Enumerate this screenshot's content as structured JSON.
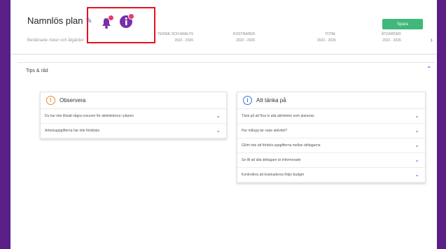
{
  "header": {
    "plan_name": "Namnlös plan",
    "edit_icon": "pencil-icon",
    "subtext": "Beräknade risker och åtgärder",
    "save_label": "Spara",
    "stats": [
      {
        "label": "TEKNIK OCH ANALYS",
        "value": "2022 - 2026"
      },
      {
        "label": "KOSTNADER",
        "value": "2022 - 2026"
      },
      {
        "label": "TOTAL",
        "value": "2022 - 2026"
      },
      {
        "label": "ÅTGÄRDER",
        "value": "2022 - 2026"
      }
    ],
    "notifications": {
      "bell_icon": "bell-icon",
      "info_icon": "info-icon"
    }
  },
  "panel": {
    "title": "Tips & råd",
    "observation_card": {
      "title": "Observera",
      "items": [
        "Du har inte tillsatt några resurser för aktiviteterna i planen",
        "Arbetsuppgifterna har inte fördelats"
      ]
    },
    "links_card": {
      "title": "Att tänka på",
      "items": [
        "Tänk på att föra in alla aktiviteter som planeras",
        "Hur många tar varje aktivitet?",
        "Glöm inte att fördela uppgifterna mellan deltagarna",
        "Se till att alla deltagare är informerade",
        "Kontrollera att kostnaderna följer budget"
      ]
    }
  },
  "colors": {
    "brand": "#5a1f86",
    "accent": "#3d6fd6",
    "warn": "#f0872e",
    "highlight": "#e0141e",
    "save": "#3fb87a"
  }
}
